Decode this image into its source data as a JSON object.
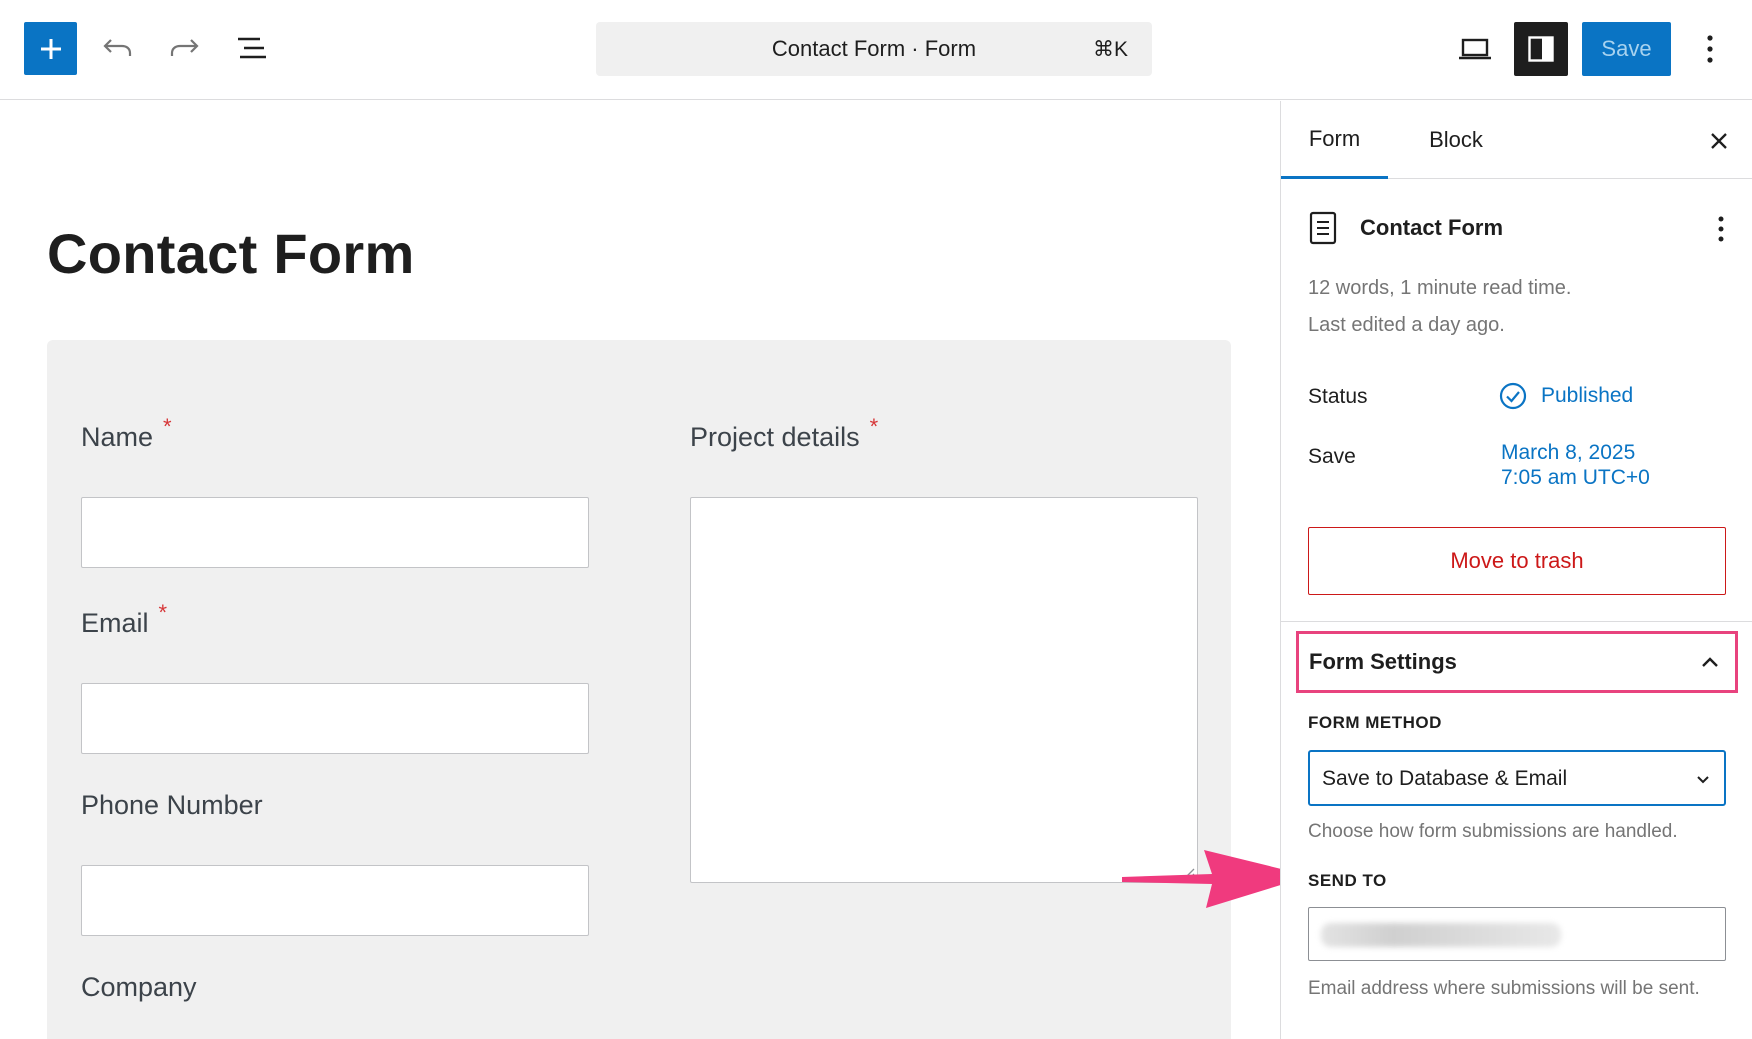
{
  "toolbar": {
    "command_title": "Contact Form · Form",
    "command_shortcut": "⌘K",
    "save_label": "Save",
    "icons": [
      "plus-icon",
      "undo-icon",
      "redo-icon",
      "list-view-icon",
      "desktop-preview-icon",
      "settings-panel-icon",
      "more-vertical-icon"
    ],
    "accent_color": "#0a74c4"
  },
  "canvas": {
    "page_title": "Contact Form",
    "fields": {
      "name": {
        "label": "Name",
        "required_mark": "*"
      },
      "email": {
        "label": "Email",
        "required_mark": "*"
      },
      "phone": {
        "label": "Phone Number"
      },
      "company": {
        "label": "Company"
      },
      "project": {
        "label": "Project details",
        "required_mark": "*"
      }
    }
  },
  "sidebar": {
    "tabs": [
      {
        "label": "Form"
      },
      {
        "label": "Block"
      }
    ],
    "active_tab": "Form",
    "document": {
      "title": "Contact Form",
      "meta_words": "12 words, 1 minute read time.",
      "meta_edited": "Last edited a day ago."
    },
    "status": {
      "label": "Status",
      "value": "Published"
    },
    "save": {
      "label": "Save",
      "date": "March 8, 2025",
      "time": "7:05 am UTC+0"
    },
    "trash_label": "Move to trash",
    "form_settings": {
      "title": "Form Settings",
      "method_label": "FORM METHOD",
      "method_value": "Save to Database & Email",
      "method_help": "Choose how form submissions are handled.",
      "send_to_label": "SEND TO",
      "send_to_help": "Email address where submissions will be sent."
    },
    "annotation_color": "#e8437e",
    "danger_color": "#cc1818"
  }
}
